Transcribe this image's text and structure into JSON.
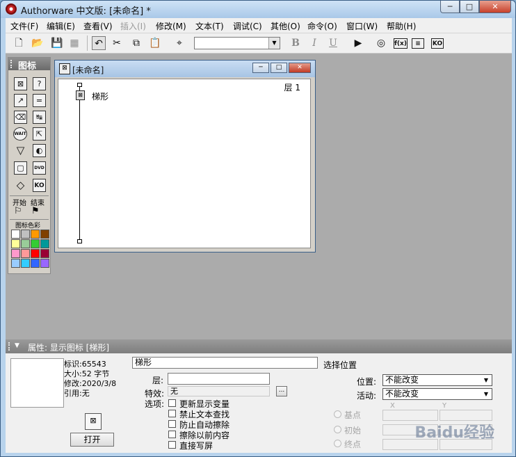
{
  "window": {
    "title": "Authorware 中文版: [未命名] *",
    "buttons": {
      "minimize": "─",
      "maximize": "□",
      "close": "✕"
    }
  },
  "menu": [
    "文件(F)",
    "编辑(E)",
    "查看(V)",
    "插入(I)",
    "修改(M)",
    "文本(T)",
    "调试(C)",
    "其他(O)",
    "命令(O)",
    "窗口(W)",
    "帮助(H)"
  ],
  "menu_disabled": [
    "插入(I)"
  ],
  "toolbar": {
    "icons": [
      "new-file-icon",
      "open-folder-icon",
      "save-all-icon",
      "import-icon",
      "undo-icon",
      "cut-icon",
      "copy-icon",
      "paste-icon",
      "find-icon",
      "bold-icon",
      "italic-icon",
      "underline-icon",
      "run-icon",
      "control-panel-icon",
      "functions-icon",
      "variables-icon",
      "knowledge-objects-icon"
    ],
    "font_value": "",
    "bold": "B",
    "italic": "I",
    "underline": "U",
    "fn_label": "f(x)",
    "ko_label": "KO"
  },
  "palette": {
    "title": "图标",
    "wait_label": "WAIT",
    "dvd_label": "DVD",
    "ko_label": "KO",
    "start_label": "开始",
    "end_label": "结束",
    "color_title": "图标色彩",
    "colors": [
      "#ffffff",
      "#c0c0c0",
      "#ff9900",
      "#804000",
      "#ffff99",
      "#99cc99",
      "#33cc33",
      "#009999",
      "#ff99cc",
      "#ff9999",
      "#ff0000",
      "#990033",
      "#99ccff",
      "#33ccff",
      "#3366ff",
      "#9966ff"
    ]
  },
  "design_window": {
    "title": "[未命名]",
    "level_label": "层 1",
    "icon_label": "梯形"
  },
  "properties": {
    "header": "属性: 显示图标 [梯形]",
    "info": {
      "id": "标识:65543",
      "size": "大小:52 字节",
      "modified": "修改:2020/3/8",
      "ref": "引用:无"
    },
    "open_button": "打开",
    "name_value": "梯形",
    "choose_position": "选择位置",
    "layer_label": "层:",
    "layer_value": "",
    "effect_label": "特效:",
    "effect_value": "无",
    "options_label": "选项:",
    "options": [
      "更新显示变量",
      "禁止文本查找",
      "防止自动擦除",
      "擦除以前内容",
      "直接写屏"
    ],
    "position_label": "位置:",
    "position_value": "不能改变",
    "active_label": "活动:",
    "active_value": "不能改变",
    "radio_labels": [
      "基点",
      "初始",
      "终点"
    ],
    "x_header": "X",
    "y_header": "Y"
  },
  "watermark": "Baidu经验"
}
